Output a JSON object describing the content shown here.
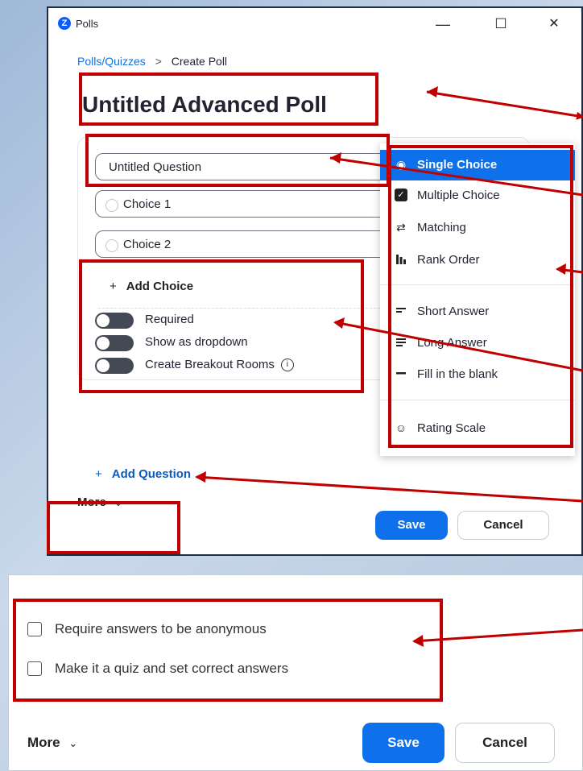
{
  "window": {
    "app_icon": "zoom-logo",
    "title": "Polls",
    "minimize": "—",
    "maximize": "☐",
    "close": "✕"
  },
  "breadcrumb": {
    "link": "Polls/Quizzes",
    "separator": ">",
    "current": "Create Poll"
  },
  "poll": {
    "title": "Untitled Advanced Poll",
    "question_placeholder": "Untitled Question",
    "choices": [
      "Choice 1",
      "Choice 2"
    ],
    "add_choice": "Add Choice",
    "toggles": [
      {
        "label": "Required",
        "on": false
      },
      {
        "label": "Show as dropdown",
        "on": false
      },
      {
        "label": "Create Breakout Rooms",
        "on": false
      }
    ],
    "add_question": "Add Question"
  },
  "question_types": {
    "selected": "Single Choice",
    "groups": [
      [
        {
          "label": "Single Choice",
          "icon": "radio-selected-icon"
        },
        {
          "label": "Multiple Choice",
          "icon": "checkbox-checked-icon"
        },
        {
          "label": "Matching",
          "icon": "shuffle-icon"
        },
        {
          "label": "Rank Order",
          "icon": "bar-chart-icon"
        }
      ],
      [
        {
          "label": "Short Answer",
          "icon": "short-lines-icon"
        },
        {
          "label": "Long Answer",
          "icon": "long-lines-icon"
        },
        {
          "label": "Fill in the blank",
          "icon": "dash-icon"
        }
      ],
      [
        {
          "label": "Rating Scale",
          "icon": "smiley-icon"
        }
      ]
    ]
  },
  "footer": {
    "more": "More",
    "save": "Save",
    "cancel": "Cancel"
  },
  "more_options": [
    {
      "label": "Require answers to be anonymous",
      "checked": false
    },
    {
      "label": "Make it a quiz and set correct answers",
      "checked": false
    }
  ],
  "colors": {
    "accent": "#0e71eb",
    "highlight": "#c00000"
  }
}
